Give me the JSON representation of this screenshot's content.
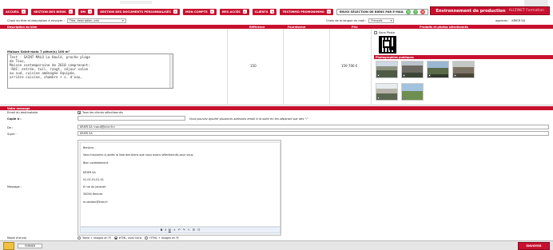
{
  "tabs": [
    {
      "label": "ACCUEIL"
    },
    {
      "label": "GESTION DES BIENS"
    },
    {
      "label": "DM"
    },
    {
      "label": "GESTION DES DOCUMENTS PERSONNALISÉS"
    },
    {
      "label": "MON COMPTE"
    },
    {
      "label": "MES ACCÈS"
    },
    {
      "label": "CLIENTS"
    },
    {
      "label": "TESTIMMO PROMONIMMO"
    },
    {
      "label": "ENVOI SÉLECTION DE BIENS PAR E-MAIL"
    }
  ],
  "environment": {
    "label": "Environnement de production",
    "user": "ALIZINET Formation"
  },
  "choice": {
    "title_label": "Choix du titre et description à envoyer :",
    "title_value": "Titre, description, prix",
    "language_label": "Choix de la langue du mail :",
    "language_value": "Français",
    "agency_label": "agences :",
    "agency_value": "KRIER SA"
  },
  "table": {
    "headers": [
      "Description du bien",
      "Référence",
      "Fournisseur",
      "Prix",
      "Produits et photos sélectionnés"
    ],
    "property": {
      "title": "Maison Saint-malo 7 pièce(s) 100 m²",
      "description": "Test - SAINT MALO La Haulé, proche plage\nde Tous,\nMaison contemporaine de 2010 comprenant:\n-RdC: entrée, toil. rangt, séjour-salon\nau sud, cuisine aménagée équipée,\narrière cuisine, chambre + s. d'eau,",
      "reference": "150",
      "price": "159 700 €"
    },
    "sans_photo_label": "Sans Photo",
    "photos_header": "Photographies publiques"
  },
  "message_section": {
    "header": "Votre message",
    "email_label": "Email du destinataire",
    "all_clients_label": "Tous les clients sélectionnés",
    "copy_label": "Copie à :",
    "copy_hint": "Vous pouvez ajouter plusieurs adresses email à la suite en les séparant par des \";\"",
    "from_label": "De :",
    "from_value": "KRIER SA <sauf@krier.fr>",
    "subject_label": "Sujet :",
    "subject_value": "KRIER SA",
    "message_label": "Message :",
    "body": {
      "greeting": "Bonjour,",
      "line1": "Vous trouverez ci-après la liste des biens que nous avons sélectionnés pour vous.",
      "closing": "Bien cordialement.",
      "signature_name": "KRIER SA",
      "signature_phone": "01.01.01.01.01",
      "signature_street": "6 rue du Jouanet",
      "signature_city": "35000 Rennes",
      "signature_email": "m.dardon@krier.fr"
    },
    "mode_label": "Mode d'envoi",
    "modes": [
      "Texte + images en PJ",
      "HTML, avec liens",
      "HTML + images en PJ"
    ]
  },
  "footer": {
    "close_label": "FERMER",
    "send_label": "ENVOYER"
  },
  "colors": {
    "accent": "#c8102e"
  }
}
